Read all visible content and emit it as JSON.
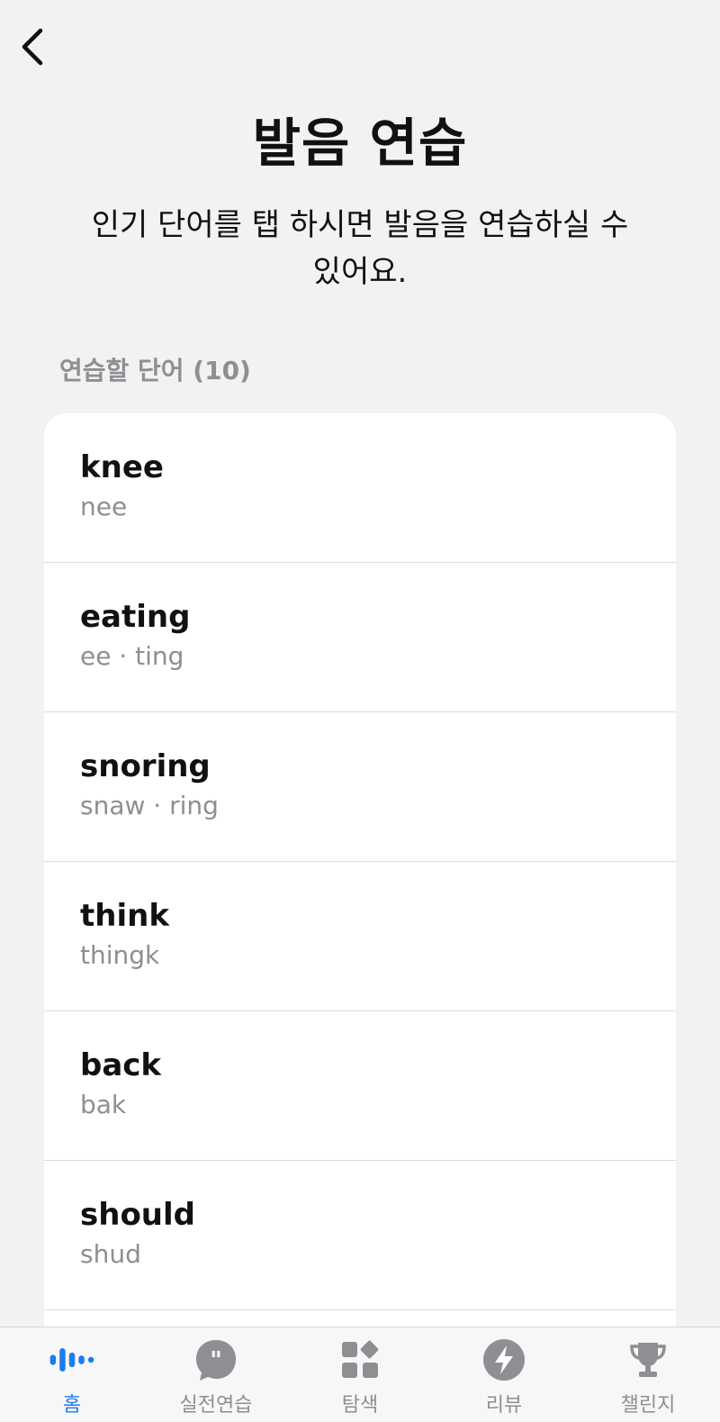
{
  "header": {
    "title": "발음 연습",
    "subtitle": "인기 단어를 탭 하시면 발음을 연습하실 수 있어요."
  },
  "section": {
    "label": "연습할 단어 (10)"
  },
  "words": [
    {
      "word": "knee",
      "phonetic": "nee"
    },
    {
      "word": "eating",
      "phonetic": "ee · ting"
    },
    {
      "word": "snoring",
      "phonetic": "snaw · ring"
    },
    {
      "word": "think",
      "phonetic": "thingk"
    },
    {
      "word": "back",
      "phonetic": "bak"
    },
    {
      "word": "should",
      "phonetic": "shud"
    },
    {
      "word": "",
      "phonetic": ""
    }
  ],
  "tabbar": {
    "tabs": [
      {
        "label": "홈",
        "icon": "waveform-icon",
        "active": true
      },
      {
        "label": "실전연습",
        "icon": "quote-bubble-icon",
        "active": false
      },
      {
        "label": "탐색",
        "icon": "grid-icon",
        "active": false
      },
      {
        "label": "리뷰",
        "icon": "lightning-icon",
        "active": false
      },
      {
        "label": "챌린지",
        "icon": "trophy-icon",
        "active": false
      }
    ]
  },
  "colors": {
    "accent": "#1c7cf4",
    "inactive": "#8e8e93",
    "background": "#f2f2f2"
  }
}
